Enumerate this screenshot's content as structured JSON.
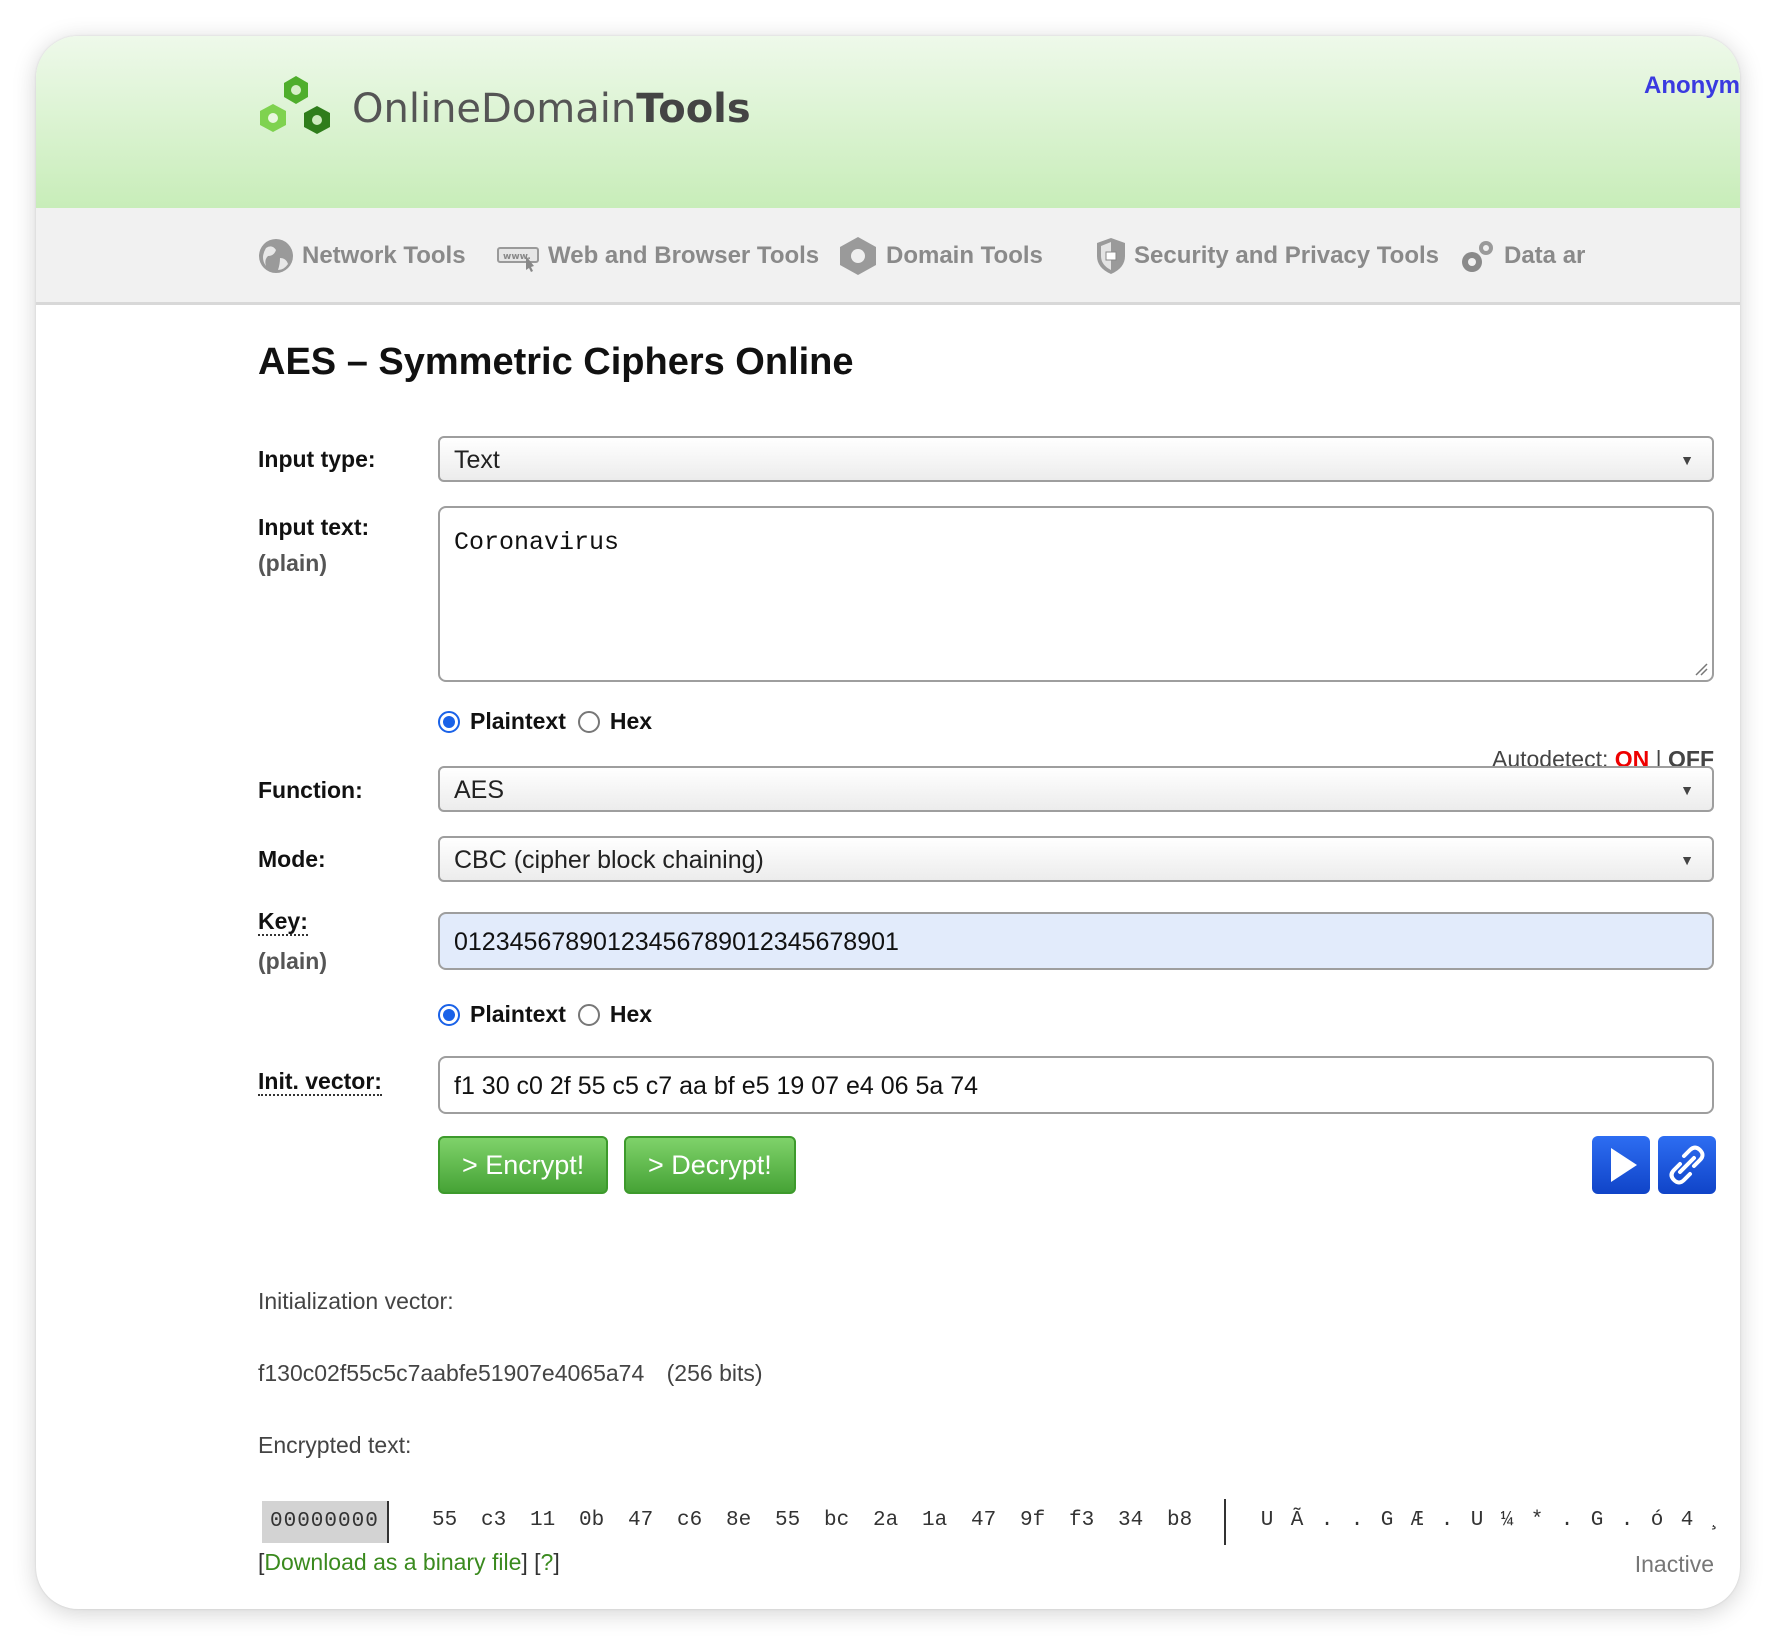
{
  "header": {
    "logo_light": "Online",
    "logo_mid": "Domain",
    "logo_bold": "Tools",
    "account_link": "Anonym",
    "brand_green": "#6cc644"
  },
  "nav": {
    "items": [
      {
        "label": "Network Tools",
        "icon": "globe-icon"
      },
      {
        "label": "Web and Browser Tools",
        "icon": "www-icon"
      },
      {
        "label": "Domain Tools",
        "icon": "hexagon-icon"
      },
      {
        "label": "Security and Privacy Tools",
        "icon": "shield-icon"
      },
      {
        "label": "Data ar",
        "icon": "gears-icon"
      }
    ]
  },
  "page": {
    "title": "AES – Symmetric Ciphers Online"
  },
  "form": {
    "input_type_label": "Input type:",
    "input_type_value": "Text",
    "input_text_label": "Input text:",
    "input_text_sub": "(plain)",
    "input_text_value": "Coronavirus",
    "radio_plaintext": "Plaintext",
    "radio_hex": "Hex",
    "autodetect_label": "Autodetect:",
    "autodetect_on": "ON",
    "autodetect_sep": "|",
    "autodetect_off": "OFF",
    "function_label": "Function:",
    "function_value": "AES",
    "mode_label": "Mode:",
    "mode_value": "CBC (cipher block chaining)",
    "key_label": "Key:",
    "key_sub": "(plain)",
    "key_value": "01234567890123456789012345678901",
    "iv_label": "Init. vector:",
    "iv_value": "f1 30 c0 2f 55 c5 c7 aa bf e5 19 07 e4 06 5a 74",
    "encrypt_button": "> Encrypt!",
    "decrypt_button": "> Decrypt!"
  },
  "results": {
    "iv_heading": "Initialization vector:",
    "iv_hex": "f130c02f55c5c7aabfe51907e4065a74",
    "iv_bits": "(256 bits)",
    "encrypted_heading": "Encrypted text:",
    "offset": "00000000",
    "bytes": [
      "55",
      "c3",
      "11",
      "0b",
      "47",
      "c6",
      "8e",
      "55",
      "bc",
      "2a",
      "1a",
      "47",
      "9f",
      "f3",
      "34",
      "b8"
    ],
    "ascii": [
      "U",
      "Ã",
      ".",
      ".",
      "G",
      "Æ",
      ".",
      "U",
      "¼",
      "*",
      ".",
      "G",
      ".",
      "ó",
      "4",
      "¸"
    ],
    "download_open": "[",
    "download_link": "Download as a binary file",
    "download_close": "]",
    "help_open": "[",
    "help_link": "?",
    "help_close": "]",
    "status": "Inactive"
  }
}
